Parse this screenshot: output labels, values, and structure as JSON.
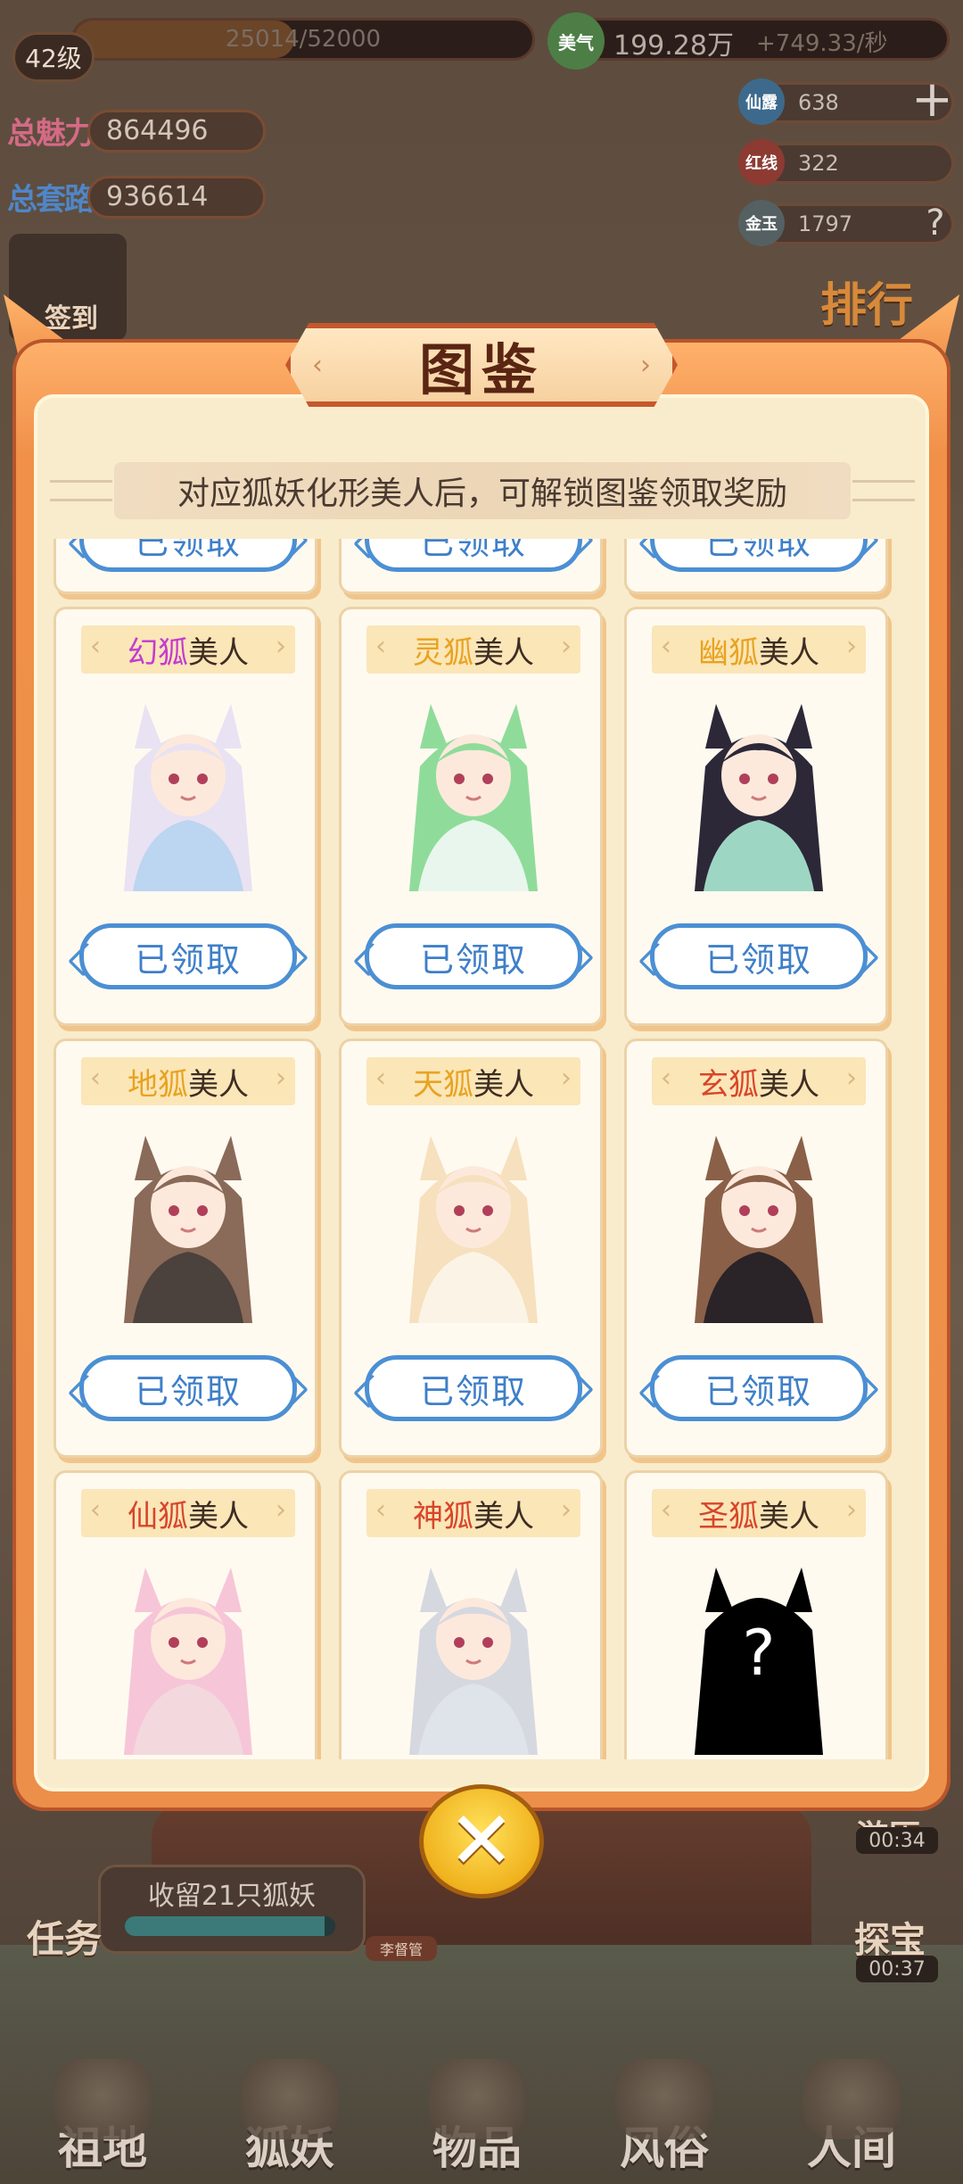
{
  "hud": {
    "level": "42级",
    "xp": "25014/52000",
    "xp_fraction": 0.481,
    "charm_label": "总魅力",
    "charm_value": "864496",
    "wealth_label": "总套路",
    "wealth_value": "936614",
    "beauty_icon": "美气",
    "beauty_value": "199.28万",
    "beauty_rate": "+749.33/秒",
    "resources": [
      {
        "icon": "仙露",
        "value": "638"
      },
      {
        "icon": "红线",
        "value": "322"
      },
      {
        "icon": "金玉",
        "value": "1797"
      }
    ]
  },
  "background": {
    "side_left": "签到",
    "rank_label": "排行",
    "timer_1": "00:34",
    "timer_2": "00:37",
    "side_right_1": "游历",
    "side_right_2": "探宝",
    "task_label": "任务",
    "task_text": "收留21只狐妖",
    "task_progress": 0.95,
    "small_tag": "李督管",
    "nav": [
      "祖地",
      "狐妖",
      "物品",
      "风俗",
      "人间"
    ]
  },
  "modal": {
    "title": "图鉴",
    "subtitle": "对应狐妖化形美人后，可解锁图鉴领取奖励",
    "claim_label": "已领取",
    "suffix": "美人",
    "cards": [
      {
        "prefix": "幻狐",
        "color": "#c43bd0",
        "hair": "#e9e2f2",
        "outfit": "#bcd5f0",
        "claimed": true,
        "locked": false
      },
      {
        "prefix": "灵狐",
        "color": "#e8a320",
        "hair": "#8fdc9a",
        "outfit": "#e8f6ee",
        "claimed": true,
        "locked": false
      },
      {
        "prefix": "幽狐",
        "color": "#e8a320",
        "hair": "#2c2838",
        "outfit": "#9ed6c4",
        "claimed": true,
        "locked": false
      },
      {
        "prefix": "地狐",
        "color": "#e8a320",
        "hair": "#8a6a58",
        "outfit": "#4b413d",
        "claimed": true,
        "locked": false
      },
      {
        "prefix": "天狐",
        "color": "#e8a320",
        "hair": "#f6e0be",
        "outfit": "#fbf4e6",
        "claimed": true,
        "locked": false
      },
      {
        "prefix": "玄狐",
        "color": "#d8452a",
        "hair": "#8a6048",
        "outfit": "#2a2328",
        "claimed": true,
        "locked": false
      },
      {
        "prefix": "仙狐",
        "color": "#d8452a",
        "hair": "#f6c6d8",
        "outfit": "#f3d8de",
        "claimed": false,
        "locked": false
      },
      {
        "prefix": "神狐",
        "color": "#d8452a",
        "hair": "#d6d8e0",
        "outfit": "#dfe3ea",
        "claimed": false,
        "locked": false
      },
      {
        "prefix": "圣狐",
        "color": "#d8452a",
        "hair": "#000000",
        "outfit": "#000000",
        "claimed": false,
        "locked": true
      }
    ],
    "close_icon": "close-icon"
  }
}
